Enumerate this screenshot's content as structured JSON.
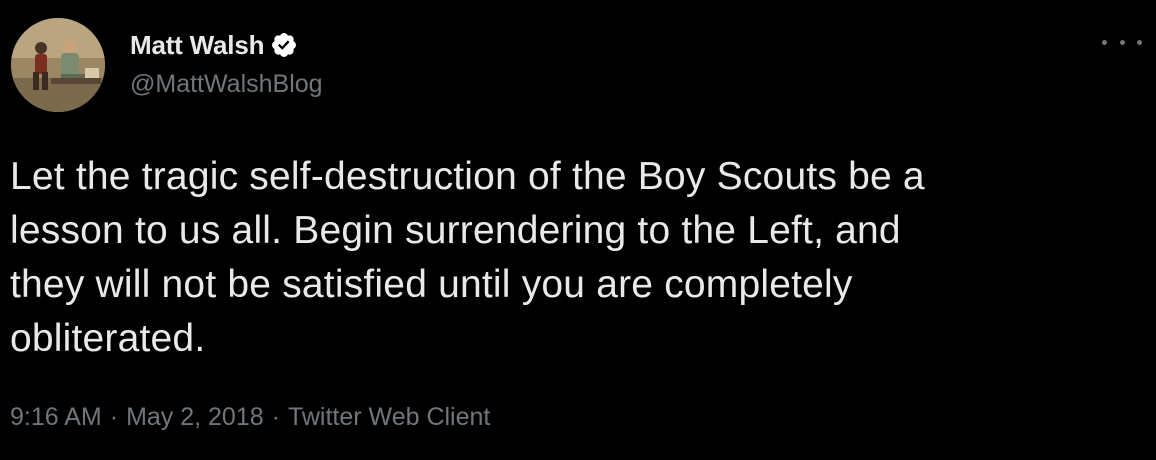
{
  "author": {
    "display_name": "Matt Walsh",
    "handle": "@MattWalshBlog",
    "verified": true,
    "avatar_icon": "profile-photo"
  },
  "tweet": {
    "text": "Let the tragic self-destruction of the Boy Scouts be a\nlesson to us all. Begin surrendering to the Left, and\nthey will not be satisfied until you are completely\nobliterated."
  },
  "meta": {
    "time": "9:16 AM",
    "date": "May 2, 2018",
    "client": "Twitter Web Client",
    "separator": "·"
  },
  "colors": {
    "background": "#000000",
    "primary_text": "#e7e9ea",
    "secondary_text": "#71767b",
    "verified_badge": "#ffffff"
  },
  "icons": {
    "more": "more-horizontal-icon",
    "verified": "verified-badge-icon"
  }
}
